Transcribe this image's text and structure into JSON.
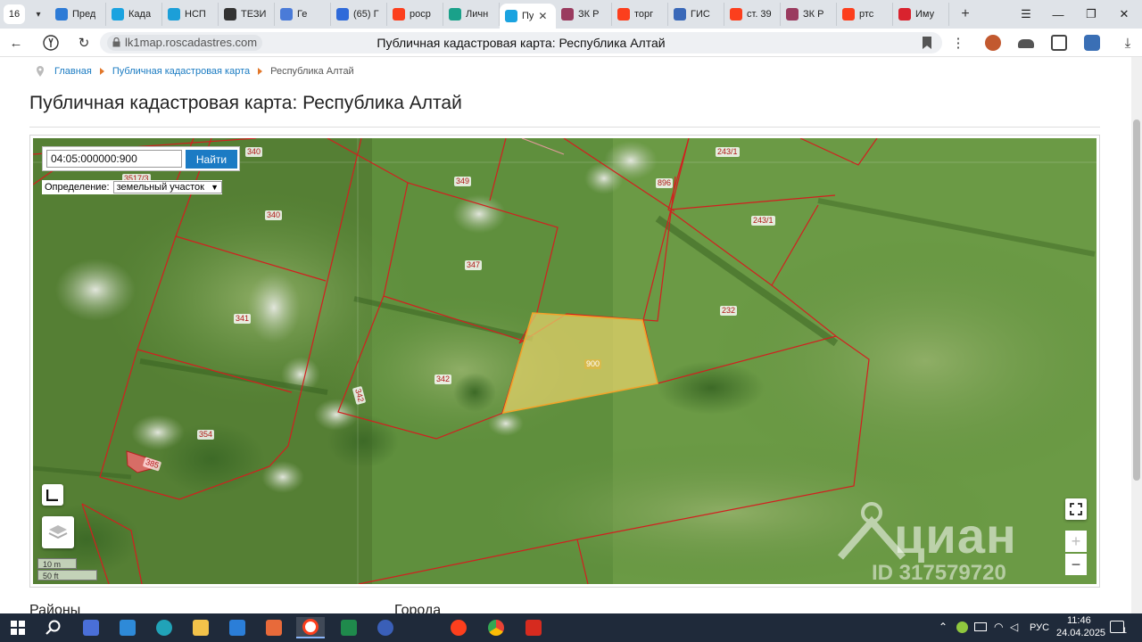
{
  "tabs": {
    "count": "16",
    "items": [
      {
        "label": "Пред",
        "color": "#2d7bd6"
      },
      {
        "label": "Када",
        "color": "#1aa3e0"
      },
      {
        "label": "НСП",
        "color": "#1c9fd8"
      },
      {
        "label": "ТЕЗИ",
        "color": "#333333"
      },
      {
        "label": "Ге",
        "color": "#4a7bd8"
      },
      {
        "label": "(65) Г",
        "color": "#2f6ad9"
      },
      {
        "label": "роср",
        "color": "#fc3f1d"
      },
      {
        "label": "Личн",
        "color": "#1aa18a"
      },
      {
        "label": "Пу",
        "color": "#1aa3e0",
        "active": true
      },
      {
        "label": "ЗК Р",
        "color": "#9a3b5f"
      },
      {
        "label": "торг",
        "color": "#fc3f1d"
      },
      {
        "label": "ГИС",
        "color": "#3968b8"
      },
      {
        "label": "ст. 39",
        "color": "#fc3f1d"
      },
      {
        "label": "ЗК Р",
        "color": "#9a3b5f"
      },
      {
        "label": "ртс",
        "color": "#fc3f1d"
      },
      {
        "label": "Иму",
        "color": "#d9232e"
      }
    ],
    "new_tab": "+"
  },
  "window": {
    "menu": "☰",
    "minimize": "—",
    "maximize": "❐",
    "close": "✕"
  },
  "address": {
    "domain": "lk1map.roscadastres.com",
    "title": "Публичная кадастровая карта: Республика Алтай"
  },
  "breadcrumb": {
    "home": "Главная",
    "level2": "Публичная кадастровая карта",
    "current": "Республика Алтай"
  },
  "page": {
    "heading": "Публичная кадастровая карта: Республика Алтай",
    "section_left": "Районы",
    "section_right": "Города"
  },
  "map": {
    "search_value": "04:05:000000:900",
    "search_button": "Найти",
    "definition_label": "Определение:",
    "definition_value": "земельный участок",
    "parcel_labels": {
      "p340a": "340",
      "p3517": "3517/3",
      "p349": "349",
      "p896": "896",
      "p2431a": "243/1",
      "p2431b": "243/1",
      "p340b": "340",
      "p347": "347",
      "p341": "341",
      "p232": "232",
      "p900": "900",
      "p342a": "342",
      "p342b": "342",
      "p354": "354",
      "p385": "385"
    },
    "scale_m": "10 m",
    "scale_ft": "50 ft",
    "zoom_in": "+",
    "zoom_out": "−",
    "watermark_brand": "циан",
    "watermark_id": "ID 317579720",
    "selected_color": "#e6d36b",
    "boundary_color": "#d21f1f"
  },
  "tray": {
    "language": "РУС",
    "time": "11:46",
    "date": "24.04.2025",
    "notifications": "1"
  }
}
